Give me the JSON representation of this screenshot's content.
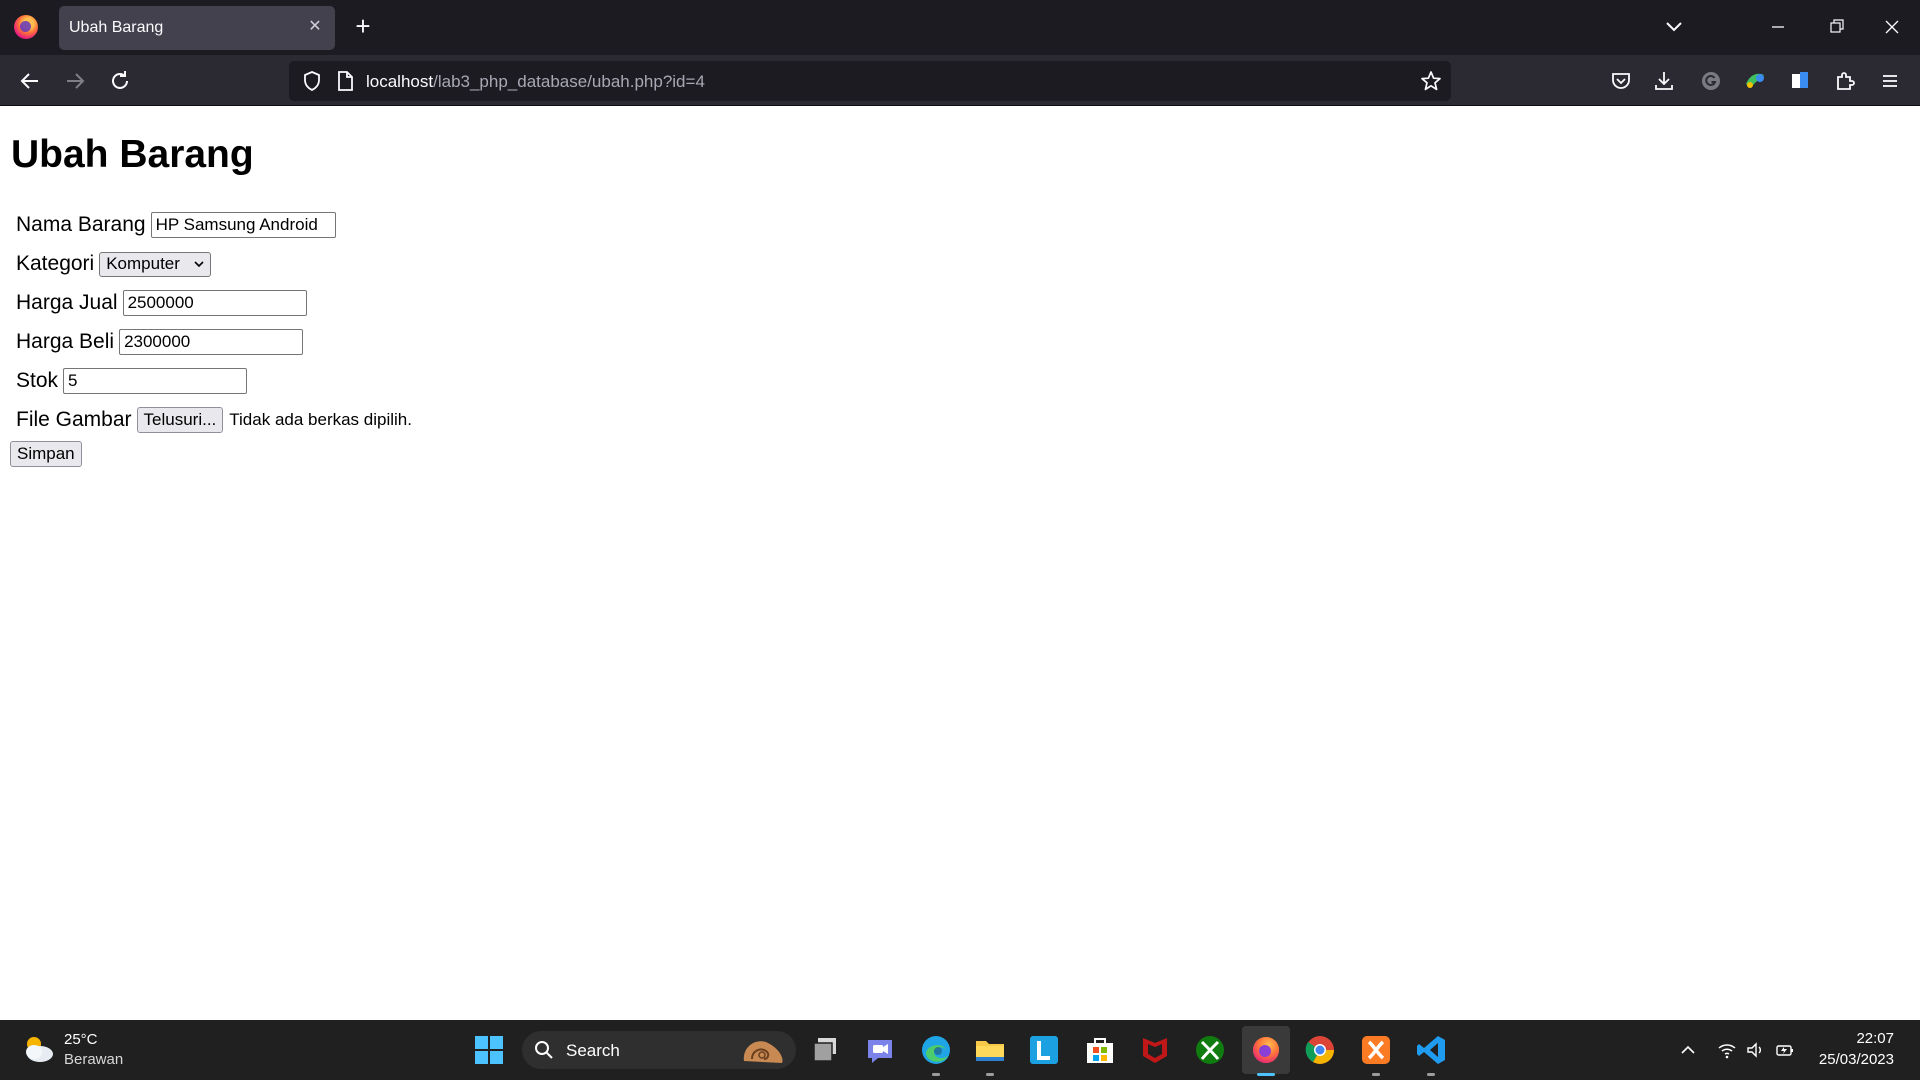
{
  "browser": {
    "tab_title": "Ubah Barang",
    "url_host": "localhost",
    "url_path": "/lab3_php_database/ubah.php?id=4"
  },
  "page": {
    "title": "Ubah Barang",
    "form": {
      "nama_label": "Nama Barang",
      "nama_value": "HP Samsung Android",
      "kategori_label": "Kategori",
      "kategori_value": "Komputer",
      "harga_jual_label": "Harga Jual",
      "harga_jual_value": "2500000",
      "harga_beli_label": "Harga Beli",
      "harga_beli_value": "2300000",
      "stok_label": "Stok",
      "stok_value": "5",
      "file_label": "File Gambar",
      "file_button": "Telusuri...",
      "file_status": "Tidak ada berkas dipilih.",
      "submit_label": "Simpan"
    }
  },
  "taskbar": {
    "weather_temp": "25°C",
    "weather_desc": "Berawan",
    "search_label": "Search",
    "time": "22:07",
    "date": "25/03/2023",
    "apps": [
      "start-icon",
      "task-view-icon",
      "teams-chat-icon",
      "edge-icon",
      "file-explorer-icon",
      "l-app-icon",
      "store-icon",
      "mcafee-icon",
      "xbox-icon",
      "firefox-icon",
      "chrome-icon",
      "xampp-icon",
      "vscode-icon"
    ]
  },
  "colors": {
    "titlebar": "#1c1b22",
    "toolbar": "#2b2a33",
    "taskbar": "#202020",
    "accent": "#4cc2ff"
  }
}
